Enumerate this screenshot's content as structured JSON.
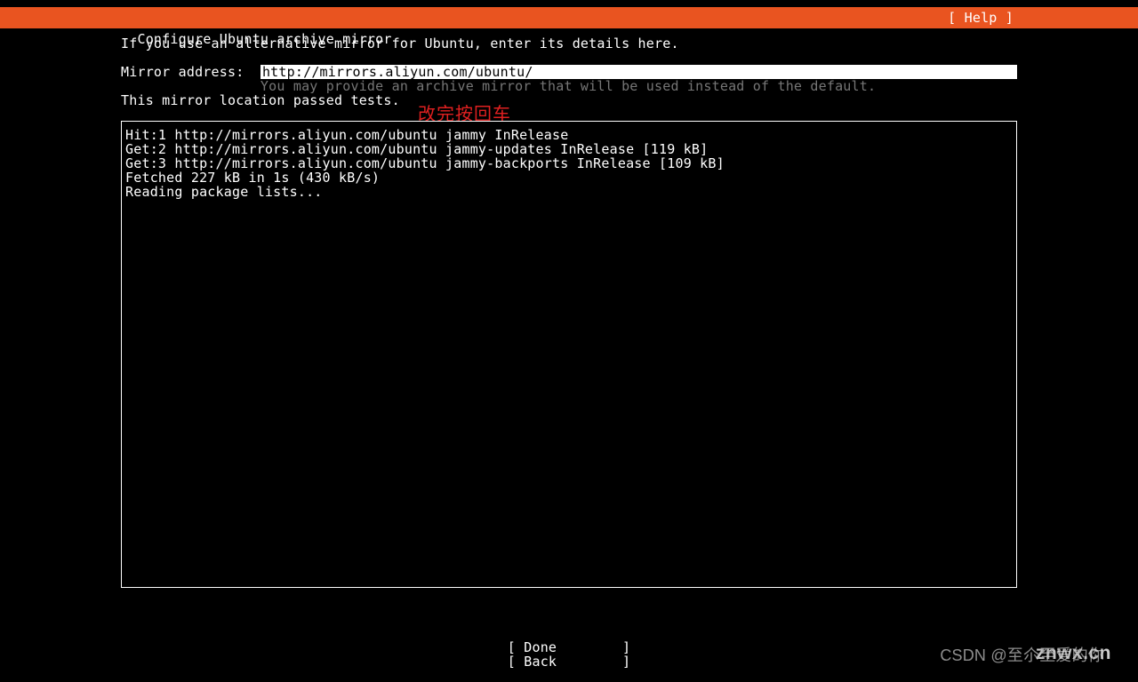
{
  "header": {
    "title": "Configure Ubuntu archive mirror",
    "help_label": "[ Help ]"
  },
  "content": {
    "intro": "If you use an alternative mirror for Ubuntu, enter its details here.",
    "mirror_label": "Mirror address:  ",
    "mirror_value": "http://mirrors.aliyun.com/ubuntu/",
    "mirror_hint": "                 You may provide an archive mirror that will be used instead of the default.",
    "annotation": "改完按回车",
    "status": "This mirror location passed tests.",
    "log": "Hit:1 http://mirrors.aliyun.com/ubuntu jammy InRelease\nGet:2 http://mirrors.aliyun.com/ubuntu jammy-updates InRelease [119 kB]\nGet:3 http://mirrors.aliyun.com/ubuntu jammy-backports InRelease [109 kB]\nFetched 227 kB in 1s (430 kB/s)\nReading package lists..."
  },
  "nav": {
    "done": "[ Done        ]",
    "back": "[ Back        ]"
  },
  "watermark": {
    "right": "CSDN @至尒至爱的你",
    "logo": "znwx.cn"
  }
}
